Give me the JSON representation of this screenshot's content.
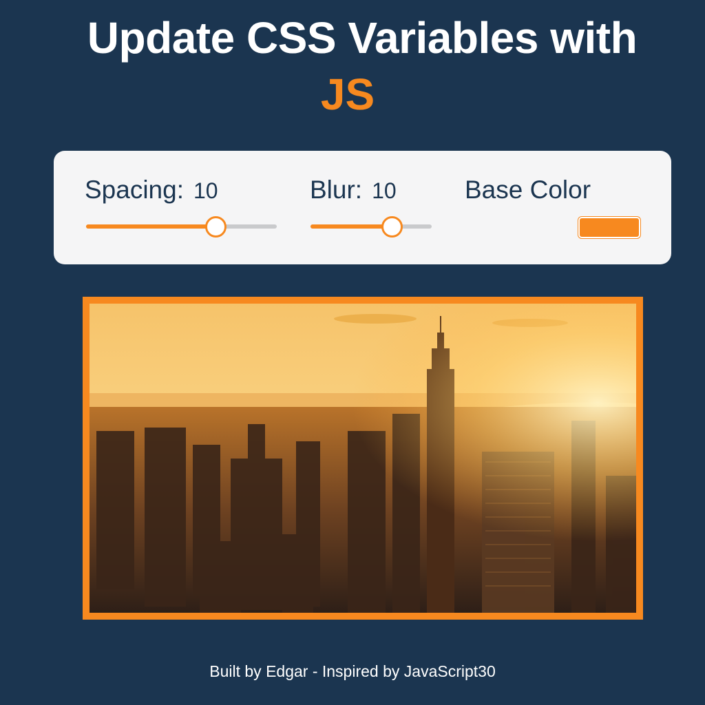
{
  "header": {
    "title_main": "Update CSS Variables with",
    "title_accent": "JS"
  },
  "controls": {
    "spacing": {
      "label": "Spacing:",
      "value": "10",
      "level": 0.68
    },
    "blur": {
      "label": "Blur:",
      "value": "10",
      "level": 0.67
    },
    "base_color": {
      "label": "Base Color",
      "value": "#f7891f"
    }
  },
  "image": {
    "subject": "city skyline at sunset"
  },
  "footer": {
    "text": "Built by Edgar - Inspired by JavaScript30"
  },
  "colors": {
    "background": "#1b3550",
    "accent": "#f7891f",
    "panel": "#f5f5f6",
    "text_dark": "#1b3550"
  }
}
